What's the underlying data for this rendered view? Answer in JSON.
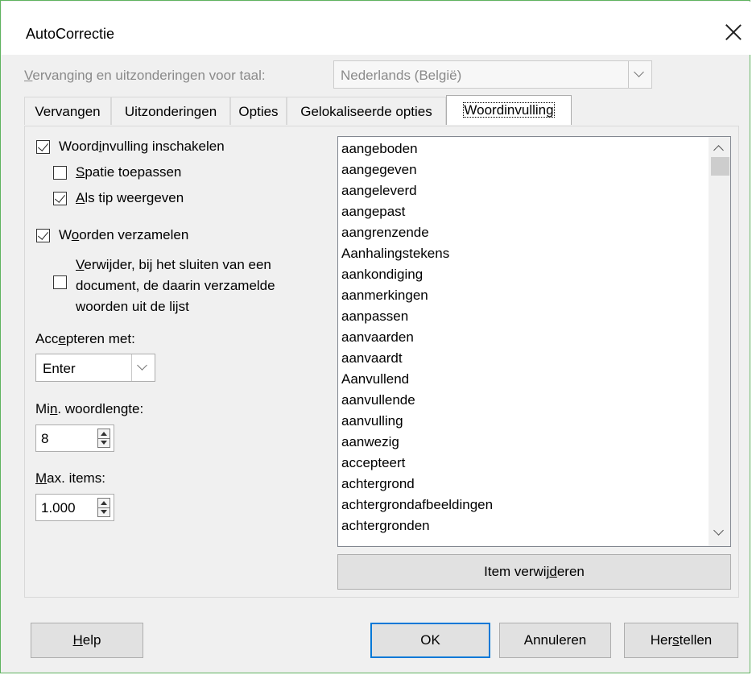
{
  "window": {
    "title": "AutoCorrectie"
  },
  "language": {
    "label_u": "V",
    "label_rest": "ervanging en uitzonderingen voor taal:",
    "value": "Nederlands (België)"
  },
  "tabs": [
    {
      "label": "Vervangen"
    },
    {
      "label": "Uitzonderingen"
    },
    {
      "label": "Opties"
    },
    {
      "label": "Gelokaliseerde opties"
    },
    {
      "label": "Woordinvulling"
    }
  ],
  "options": {
    "enable": {
      "pre": "Woord",
      "u": "i",
      "post": "nvulling inschakelen",
      "checked": true
    },
    "append_space": {
      "pre": "",
      "u": "S",
      "post": "patie toepassen",
      "checked": false
    },
    "show_tip": {
      "pre": "",
      "u": "A",
      "post": "ls tip weergeven",
      "checked": true
    },
    "collect": {
      "pre": "W",
      "u": "o",
      "post": "orden verzamelen",
      "checked": true
    },
    "remove_on_close": {
      "line1_u": "V",
      "line1_rest": "erwijder, bij het sluiten van een",
      "line2": "document, de daarin verzamelde",
      "line3": "woorden uit de lijst",
      "checked": false
    }
  },
  "accept": {
    "pre": "Acc",
    "u": "e",
    "post": "pteren met:",
    "value": "Enter"
  },
  "min_length": {
    "pre": "Mi",
    "u": "n",
    "post": ". woordlengte:",
    "value": "8"
  },
  "max_items": {
    "pre": "",
    "u": "M",
    "post": "ax. items:",
    "value": "1.000"
  },
  "word_list": [
    "aangeboden",
    "aangegeven",
    "aangeleverd",
    "aangepast",
    "aangrenzende",
    "Aanhalingstekens",
    "aankondiging",
    "aanmerkingen",
    "aanpassen",
    "aanvaarden",
    "aanvaardt",
    "Aanvullend",
    "aanvullende",
    "aanvulling",
    "aanwezig",
    "accepteert",
    "achtergrond",
    "achtergrondafbeeldingen",
    "achtergronden"
  ],
  "delete_entry": {
    "pre": "Item verwij",
    "u": "d",
    "post": "eren"
  },
  "buttons": {
    "help": {
      "pre": "",
      "u": "H",
      "post": "elp"
    },
    "ok": "OK",
    "cancel": "Annuleren",
    "reset": {
      "pre": "Her",
      "u": "s",
      "post": "tellen"
    }
  }
}
